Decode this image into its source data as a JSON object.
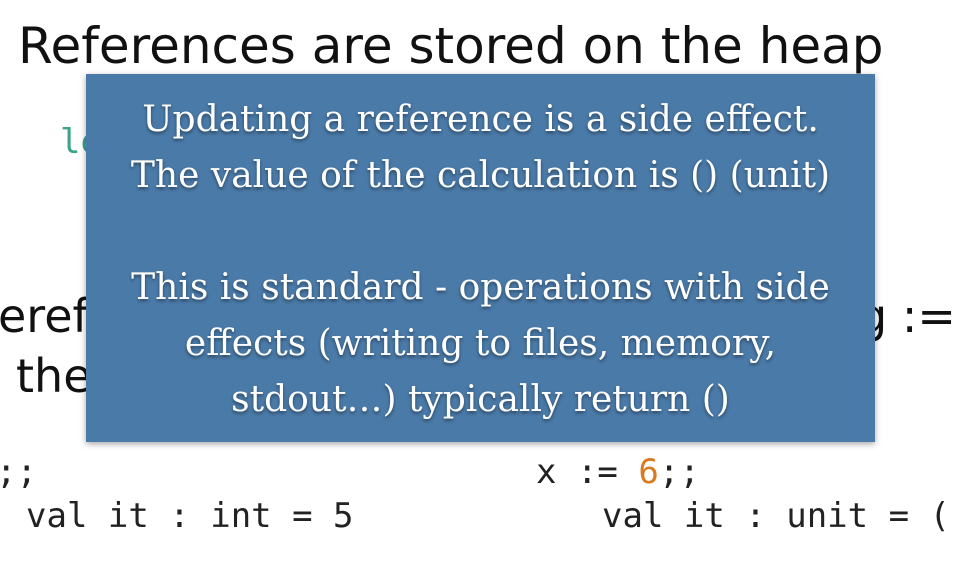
{
  "slide": {
    "title": "References are stored on the heap",
    "partial_code_top": "le",
    "left_text_1": "eref",
    "left_text_2": "the",
    "right_text": "g :=",
    "left_code": {
      "input": ";;",
      "output": "val it : int = 5"
    },
    "right_code": {
      "input_prefix": "x := ",
      "input_number": "6",
      "input_suffix": ";;",
      "output": "val it : unit = ("
    }
  },
  "overlay": {
    "line1": "Updating a reference is a side effect.",
    "line2": "The value of the calculation is () (unit)",
    "line3": "This is standard - operations with side",
    "line4": "effects (writing to files, memory,",
    "line5": "stdout…) typically return ()"
  },
  "colors": {
    "overlay_background": "#4a7aa8",
    "code_number": "#d97a1e",
    "code_keyword": "#3aa38a"
  }
}
